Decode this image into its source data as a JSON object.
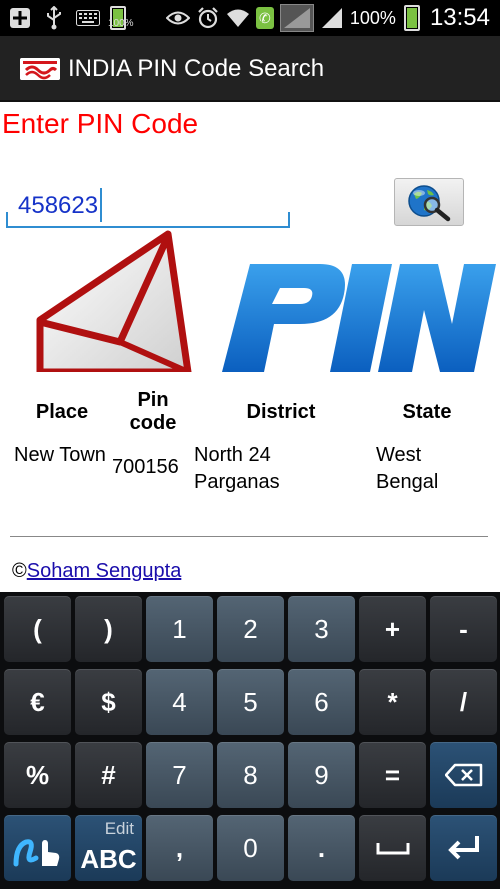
{
  "status_bar": {
    "notification_battery_pct": "100%",
    "battery_pct": "100%",
    "time": "13:54",
    "left_icons": [
      "add-icon",
      "usb-icon",
      "keyboard-icon",
      "battery-small-icon"
    ],
    "right_icons": [
      "eye-icon",
      "alarm-icon",
      "wifi-icon",
      "phone-call-icon",
      "signal-icon",
      "signal-icon",
      "battery-icon"
    ]
  },
  "action_bar": {
    "title": "INDIA PIN Code Search"
  },
  "form": {
    "heading": "Enter PIN Code",
    "pin_value": "458623"
  },
  "result_table": {
    "headers": [
      "Place",
      "Pin code",
      "District",
      "State"
    ],
    "rows": [
      [
        "New Town",
        "700156",
        "North 24 Parganas",
        "West Bengal"
      ]
    ]
  },
  "footer": {
    "copyright_symbol": "©",
    "author_link": "Soham Sengupta"
  },
  "keyboard": {
    "rows": [
      [
        "(",
        ")",
        "1",
        "2",
        "3",
        "+",
        "-"
      ],
      [
        "€",
        "$",
        "4",
        "5",
        "6",
        "*",
        "/"
      ],
      [
        "%",
        "#",
        "7",
        "8",
        "9",
        "=",
        "⌫"
      ],
      [
        "swype",
        "ABC",
        ",",
        "0",
        ".",
        "space",
        "enter"
      ]
    ],
    "abc_edit_label": "Edit",
    "abc_label": "ABC"
  },
  "colors": {
    "heading": "#ff0000",
    "input_text": "#1633c8",
    "input_underline": "#2f8dd1",
    "battery_green": "#7bc142",
    "link": "#1a0dab"
  }
}
